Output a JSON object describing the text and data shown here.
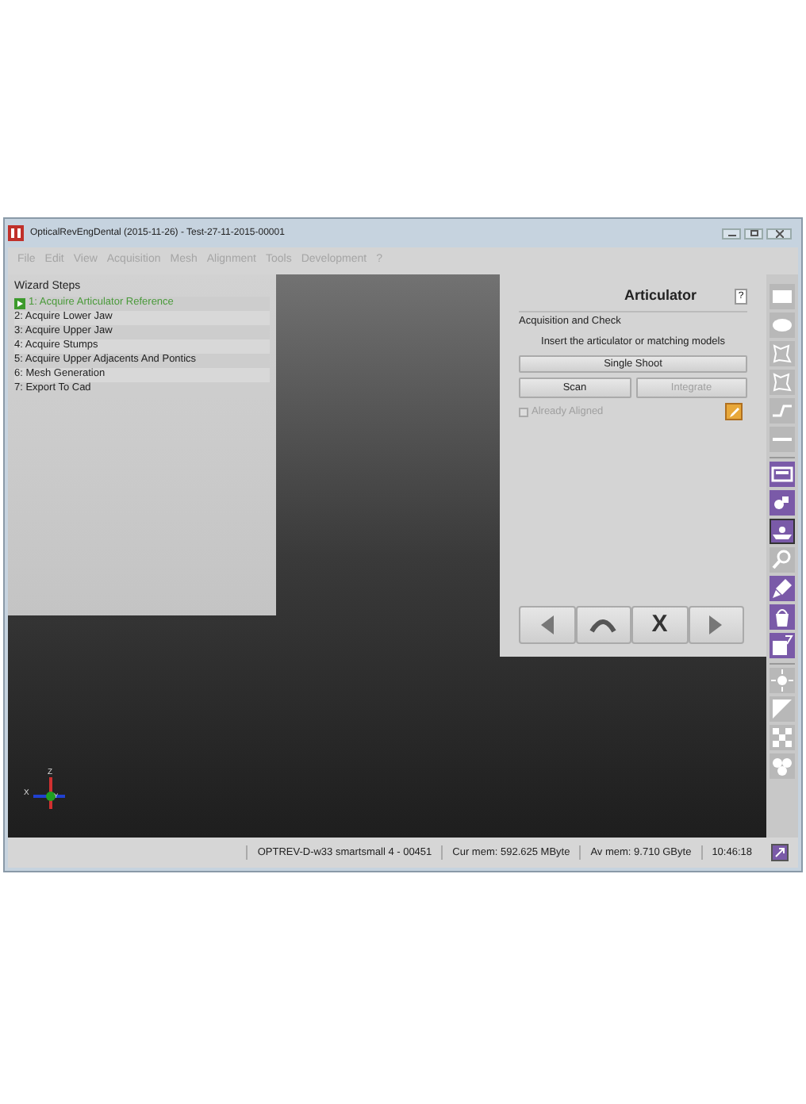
{
  "window": {
    "title": "OpticalRevEngDental (2015-11-26) - Test-27-11-2015-00001"
  },
  "menu": [
    {
      "label": "File",
      "disabled": true
    },
    {
      "label": "Edit",
      "disabled": true
    },
    {
      "label": "View",
      "disabled": true
    },
    {
      "label": "Acquisition",
      "disabled": true
    },
    {
      "label": "Mesh",
      "disabled": true
    },
    {
      "label": "Alignment",
      "disabled": true
    },
    {
      "label": "Tools",
      "disabled": true
    },
    {
      "label": "Development",
      "disabled": true
    },
    {
      "label": "?",
      "disabled": true
    }
  ],
  "wizard": {
    "title": "Wizard Steps",
    "steps": [
      {
        "label": "1: Acquire Articulator Reference",
        "selected": true
      },
      {
        "label": "2: Acquire Lower Jaw",
        "selected": false
      },
      {
        "label": "3: Acquire Upper Jaw",
        "selected": false
      },
      {
        "label": "4: Acquire Stumps",
        "selected": false
      },
      {
        "label": "5: Acquire Upper Adjacents And Pontics",
        "selected": false
      },
      {
        "label": "6: Mesh Generation",
        "selected": false
      },
      {
        "label": "7: Export To Cad",
        "selected": false
      }
    ]
  },
  "panel": {
    "title": "Articulator",
    "help": "?",
    "group": "Acquisition and Check",
    "instruction": "Insert the articulator or matching models",
    "buttons": [
      {
        "label": "Single Shoot",
        "disabled": false
      },
      {
        "label": "Scan",
        "disabled": false
      },
      {
        "label": "Integrate",
        "disabled": true
      }
    ],
    "checkbox": {
      "label": "Already Aligned",
      "checked": false,
      "disabled": true
    },
    "nav": [
      {
        "kind": "back"
      },
      {
        "kind": "undo"
      },
      {
        "kind": "text",
        "label": "X"
      },
      {
        "kind": "next"
      }
    ]
  },
  "axes": {
    "x": "X",
    "y": "Y",
    "z": "Z"
  },
  "toolbar": [
    [
      {
        "kind": "rectangle",
        "enabled": false,
        "selected": false
      },
      {
        "kind": "ellipse",
        "enabled": false,
        "selected": false
      },
      {
        "kind": "lasso",
        "enabled": false,
        "selected": false
      },
      {
        "kind": "lasso",
        "enabled": false,
        "selected": false
      },
      {
        "kind": "zigzag",
        "enabled": false,
        "selected": false
      },
      {
        "kind": "line",
        "enabled": false,
        "selected": false
      }
    ],
    [
      {
        "kind": "screen",
        "enabled": true,
        "selected": false
      },
      {
        "kind": "paint",
        "enabled": true,
        "selected": false
      },
      {
        "kind": "tray",
        "enabled": true,
        "selected": true
      },
      {
        "kind": "magnifier",
        "enabled": false,
        "selected": false
      },
      {
        "kind": "brush",
        "enabled": true,
        "selected": false
      },
      {
        "kind": "bucket",
        "enabled": true,
        "selected": false
      },
      {
        "kind": "fill",
        "enabled": true,
        "selected": false
      }
    ],
    [
      {
        "kind": "sun",
        "enabled": false,
        "selected": false
      },
      {
        "kind": "gradient",
        "enabled": false,
        "selected": false
      },
      {
        "kind": "checker",
        "enabled": false,
        "selected": false
      },
      {
        "kind": "flower",
        "enabled": false,
        "selected": false
      }
    ]
  ],
  "status_bar": [
    "OPTREV-D-w33 smartsmall 4 - 00451",
    "Cur mem: 592.625 MByte",
    "Av mem: 9.710 GByte",
    "10:46:18"
  ]
}
